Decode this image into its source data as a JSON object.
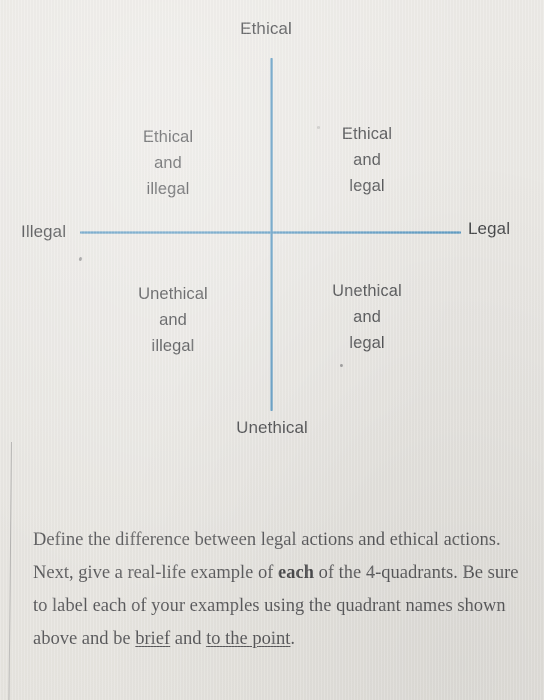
{
  "diagram": {
    "type": "2x2-quadrant-matrix",
    "axes": {
      "top_label": "Ethical",
      "bottom_label": "Unethical",
      "left_label": "Illegal",
      "right_label": "Legal"
    },
    "axis_color": "#5e9bc3",
    "quadrants": [
      {
        "id": "upper-left",
        "lines": [
          "Ethical",
          "and",
          "illegal"
        ]
      },
      {
        "id": "upper-right",
        "lines": [
          "Ethical",
          "and",
          "legal"
        ]
      },
      {
        "id": "lower-left",
        "lines": [
          "Unethical",
          "and",
          "illegal"
        ]
      },
      {
        "id": "lower-right",
        "lines": [
          "Unethical",
          "and",
          "legal"
        ]
      }
    ]
  },
  "prompt": {
    "seg_1": "Define the difference between legal actions and ethical actions.  Next, give a real-life example of ",
    "bold_1": "each",
    "seg_2": " of the 4-quadrants.  Be sure to label each of your examples using the quadrant names shown above and be ",
    "underline_1": "brief",
    "seg_3": " and ",
    "underline_2": "to the point",
    "seg_4": "."
  },
  "colors": {
    "background": "#e9e7e2",
    "axis": "#5e9bc3",
    "diagram_text": "#4a4b4d",
    "prompt_text": "#59595b"
  }
}
